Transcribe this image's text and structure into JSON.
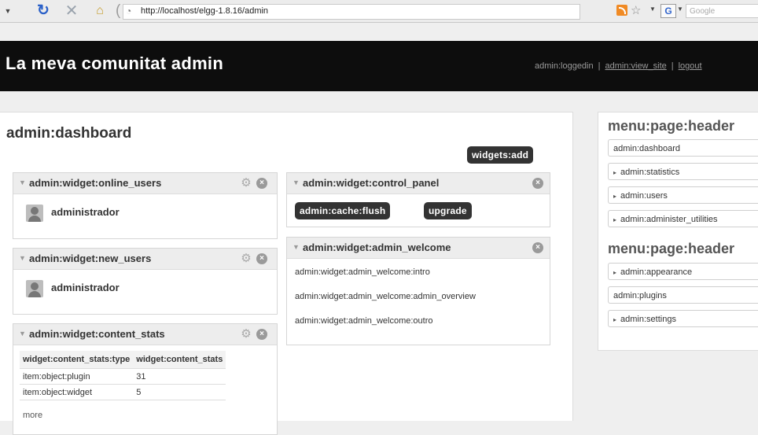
{
  "browser": {
    "url": "http://localhost/elgg-1.8.16/admin",
    "search_placeholder": "Google",
    "search_engine_letter": "G"
  },
  "header": {
    "site_title": "La meva comunitat admin",
    "status_text": "admin:loggedin",
    "view_site_link": "admin:view_site",
    "logout_link": "logout"
  },
  "page": {
    "title": "admin:dashboard",
    "widgets_add_label": "widgets:add"
  },
  "widgets": {
    "online_users": {
      "title": "admin:widget:online_users",
      "user": "administrador"
    },
    "new_users": {
      "title": "admin:widget:new_users",
      "user": "administrador"
    },
    "content_stats": {
      "title": "admin:widget:content_stats",
      "headers": [
        "widget:content_stats:type",
        "widget:content_stats"
      ],
      "rows": [
        {
          "type": "item:object:plugin",
          "count": "31"
        },
        {
          "type": "item:object:widget",
          "count": "5"
        }
      ],
      "more_link": "more"
    },
    "control_panel": {
      "title": "admin:widget:control_panel",
      "cache_flush_label": "admin:cache:flush",
      "upgrade_label": "upgrade"
    },
    "admin_welcome": {
      "title": "admin:widget:admin_welcome",
      "lines": [
        "admin:widget:admin_welcome:intro",
        "admin:widget:admin_welcome:admin_overview",
        "admin:widget:admin_welcome:outro"
      ]
    }
  },
  "sidebar": {
    "menus": [
      {
        "heading": "menu:page:header",
        "items": [
          {
            "label": "admin:dashboard",
            "expandable": false
          },
          {
            "label": "admin:statistics",
            "expandable": true
          },
          {
            "label": "admin:users",
            "expandable": true
          },
          {
            "label": "admin:administer_utilities",
            "expandable": true
          }
        ]
      },
      {
        "heading": "menu:page:header",
        "items": [
          {
            "label": "admin:appearance",
            "expandable": true
          },
          {
            "label": "admin:plugins",
            "expandable": false
          },
          {
            "label": "admin:settings",
            "expandable": true
          }
        ]
      }
    ]
  },
  "icons": {
    "toggle": "triangle-down-icon",
    "gear": "gear-icon",
    "close": "close-icon",
    "avatar": "user-avatar-icon",
    "expand_arrow": "triangle-right-icon"
  },
  "colors": {
    "header_bg": "#0d0d0d",
    "button_bg": "#333333",
    "page_bg": "#efefef"
  }
}
